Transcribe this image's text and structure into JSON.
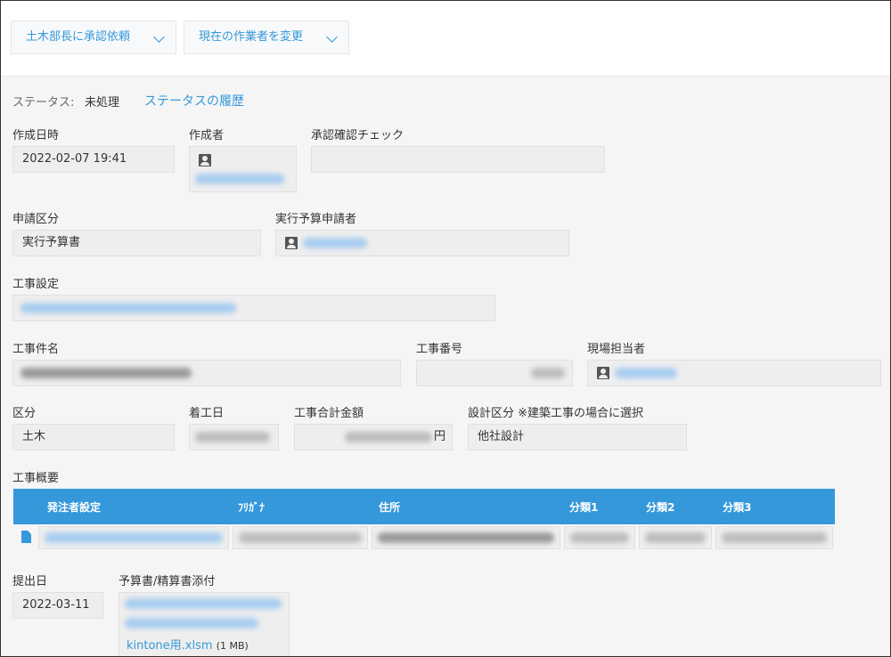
{
  "toolbar": {
    "approve_button": "土木部長に承認依頼",
    "change_assignee_button": "現在の作業者を変更"
  },
  "status": {
    "label": "ステータス:",
    "value": "未処理",
    "history_link": "ステータスの履歴"
  },
  "fields": {
    "created_at": {
      "label": "作成日時",
      "value": "2022-02-07 19:41"
    },
    "creator": {
      "label": "作成者"
    },
    "approval_check": {
      "label": "承認確認チェック"
    },
    "application_type": {
      "label": "申請区分",
      "value": "実行予算書"
    },
    "budget_applicant": {
      "label": "実行予算申請者"
    },
    "construction_setting": {
      "label": "工事設定"
    },
    "construction_name": {
      "label": "工事件名"
    },
    "construction_number": {
      "label": "工事番号"
    },
    "site_manager": {
      "label": "現場担当者"
    },
    "division": {
      "label": "区分",
      "value": "土木"
    },
    "start_date": {
      "label": "着工日"
    },
    "total_amount": {
      "label": "工事合計金額",
      "unit": "円"
    },
    "design_division": {
      "label": "設計区分 ※建築工事の場合に選択",
      "value": "他社設計"
    },
    "submission_date": {
      "label": "提出日",
      "value": "2022-03-11"
    },
    "attachment": {
      "label": "予算書/精算書添付",
      "file_name": "kintone用.xlsm",
      "file_size": "(1 MB)"
    }
  },
  "overview_table": {
    "label": "工事概要",
    "headers": [
      "発注者設定",
      "ﾌﾘｶﾞﾅ",
      "住所",
      "分類1",
      "分類2",
      "分類3"
    ]
  },
  "colors": {
    "accent": "#3498db",
    "field_bg": "#eeeeee",
    "page_bg": "#f5f5f5"
  },
  "icons": [
    "chevron-down-icon",
    "user-icon",
    "file-icon"
  ]
}
